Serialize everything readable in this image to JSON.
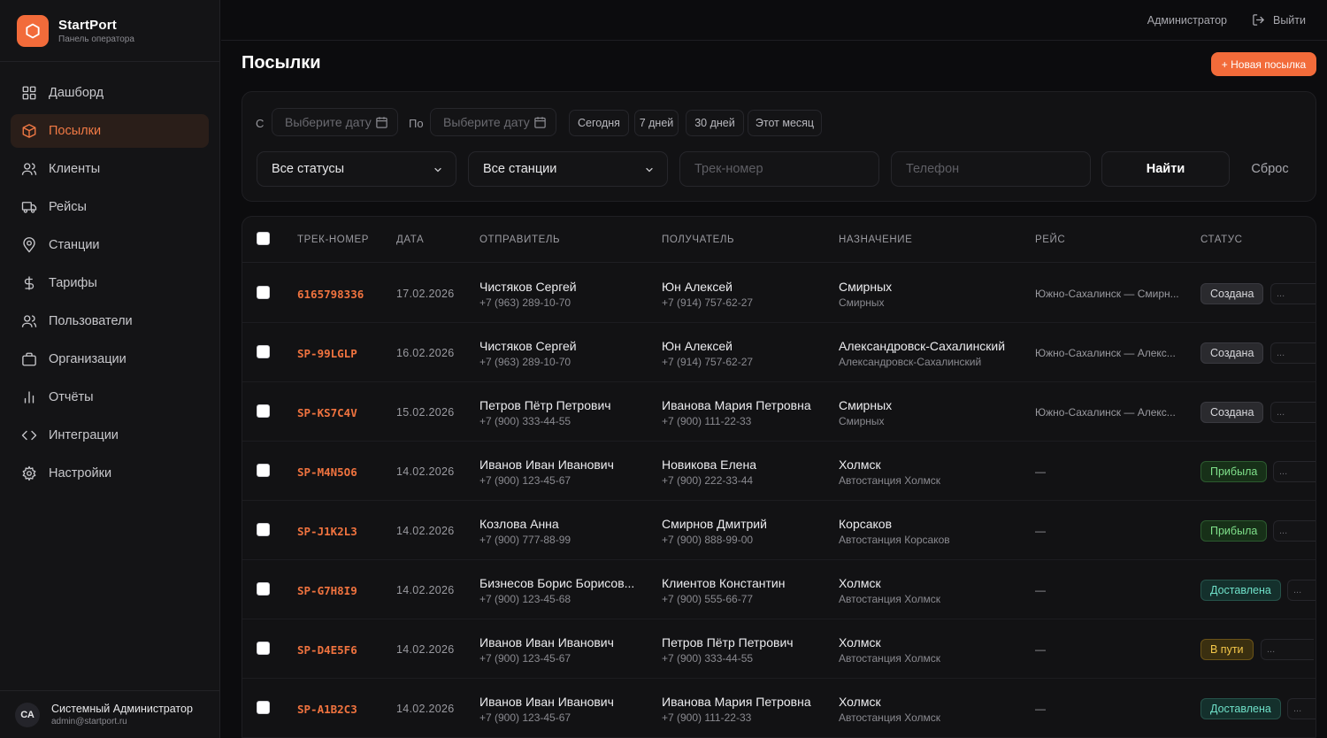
{
  "brand": {
    "name": "StartPort",
    "subtitle": "Панель оператора"
  },
  "nav": [
    {
      "label": "Дашборд",
      "icon": "dashboard-icon",
      "active": false
    },
    {
      "label": "Посылки",
      "icon": "package-icon",
      "active": true
    },
    {
      "label": "Клиенты",
      "icon": "clients-icon",
      "active": false
    },
    {
      "label": "Рейсы",
      "icon": "truck-icon",
      "active": false
    },
    {
      "label": "Станции",
      "icon": "map-pin-icon",
      "active": false
    },
    {
      "label": "Тарифы",
      "icon": "dollar-icon",
      "active": false
    },
    {
      "label": "Пользователи",
      "icon": "users-icon",
      "active": false
    },
    {
      "label": "Организации",
      "icon": "briefcase-icon",
      "active": false
    },
    {
      "label": "Отчёты",
      "icon": "bar-chart-icon",
      "active": false
    },
    {
      "label": "Интеграции",
      "icon": "code-icon",
      "active": false
    },
    {
      "label": "Настройки",
      "icon": "gear-icon",
      "active": false
    }
  ],
  "user": {
    "initials": "СА",
    "name": "Системный Администратор",
    "email": "admin@startport.ru"
  },
  "topbar": {
    "role": "Администратор",
    "logout": "Выйти"
  },
  "page": {
    "title": "Посылки",
    "new_button": "+ Новая посылка"
  },
  "filters": {
    "from_label": "С",
    "to_label": "По",
    "date_placeholder": "Выберите дату",
    "chips": [
      "Сегодня",
      "7 дней",
      "30 дней",
      "Этот месяц"
    ],
    "status_select": "Все статусы",
    "station_select": "Все станции",
    "track_placeholder": "Трек-номер",
    "phone_placeholder": "Телефон",
    "find": "Найти",
    "reset": "Сброс"
  },
  "table": {
    "headers": [
      "ТРЕК-НОМЕР",
      "ДАТА",
      "ОТПРАВИТЕЛЬ",
      "ПОЛУЧАТЕЛЬ",
      "НАЗНАЧЕНИЕ",
      "РЕЙС",
      "СТАТУС"
    ],
    "rows": [
      {
        "track": "6165798336",
        "date": "17.02.2026",
        "sender": "Чистяков Сергей",
        "sender_phone": "+7 (963) 289-10-70",
        "recipient": "Юн Алексей",
        "recipient_phone": "+7 (914) 757-62-27",
        "dest": "Смирных",
        "dest_sub": "Смирных",
        "flight": "Южно-Сахалинск — Смирн...",
        "status": "Создана",
        "status_kind": "created"
      },
      {
        "track": "SP-99LGLP",
        "date": "16.02.2026",
        "sender": "Чистяков Сергей",
        "sender_phone": "+7 (963) 289-10-70",
        "recipient": "Юн Алексей",
        "recipient_phone": "+7 (914) 757-62-27",
        "dest": "Александровск-Сахалинский",
        "dest_sub": "Александровск-Сахалинский",
        "flight": "Южно-Сахалинск — Алекс...",
        "status": "Создана",
        "status_kind": "created"
      },
      {
        "track": "SP-KS7C4V",
        "date": "15.02.2026",
        "sender": "Петров Пётр Петрович",
        "sender_phone": "+7 (900) 333-44-55",
        "recipient": "Иванова Мария Петровна",
        "recipient_phone": "+7 (900) 111-22-33",
        "dest": "Смирных",
        "dest_sub": "Смирных",
        "flight": "Южно-Сахалинск — Алекс...",
        "status": "Создана",
        "status_kind": "created"
      },
      {
        "track": "SP-M4N5O6",
        "date": "14.02.2026",
        "sender": "Иванов Иван Иванович",
        "sender_phone": "+7 (900) 123-45-67",
        "recipient": "Новикова Елена",
        "recipient_phone": "+7 (900) 222-33-44",
        "dest": "Холмск",
        "dest_sub": "Автостанция Холмск",
        "flight": "—",
        "status": "Прибыла",
        "status_kind": "arrived"
      },
      {
        "track": "SP-J1K2L3",
        "date": "14.02.2026",
        "sender": "Козлова Анна",
        "sender_phone": "+7 (900) 777-88-99",
        "recipient": "Смирнов Дмитрий",
        "recipient_phone": "+7 (900) 888-99-00",
        "dest": "Корсаков",
        "dest_sub": "Автостанция Корсаков",
        "flight": "—",
        "status": "Прибыла",
        "status_kind": "arrived"
      },
      {
        "track": "SP-G7H8I9",
        "date": "14.02.2026",
        "sender": "Бизнесов Борис Борисов...",
        "sender_phone": "+7 (900) 123-45-68",
        "recipient": "Клиентов Константин",
        "recipient_phone": "+7 (900) 555-66-77",
        "dest": "Холмск",
        "dest_sub": "Автостанция Холмск",
        "flight": "—",
        "status": "Доставлена",
        "status_kind": "delivered"
      },
      {
        "track": "SP-D4E5F6",
        "date": "14.02.2026",
        "sender": "Иванов Иван Иванович",
        "sender_phone": "+7 (900) 123-45-67",
        "recipient": "Петров Пётр Петрович",
        "recipient_phone": "+7 (900) 333-44-55",
        "dest": "Холмск",
        "dest_sub": "Автостанция Холмск",
        "flight": "—",
        "status": "В пути",
        "status_kind": "transit"
      },
      {
        "track": "SP-A1B2C3",
        "date": "14.02.2026",
        "sender": "Иванов Иван Иванович",
        "sender_phone": "+7 (900) 123-45-67",
        "recipient": "Иванова Мария Петровна",
        "recipient_phone": "+7 (900) 111-22-33",
        "dest": "Холмск",
        "dest_sub": "Автостанция Холмск",
        "flight": "—",
        "status": "Доставлена",
        "status_kind": "delivered"
      }
    ],
    "more_label": "..."
  },
  "colors": {
    "accent": "#f26b3a",
    "background": "#0c0c0e",
    "sidebar": "#141416"
  }
}
